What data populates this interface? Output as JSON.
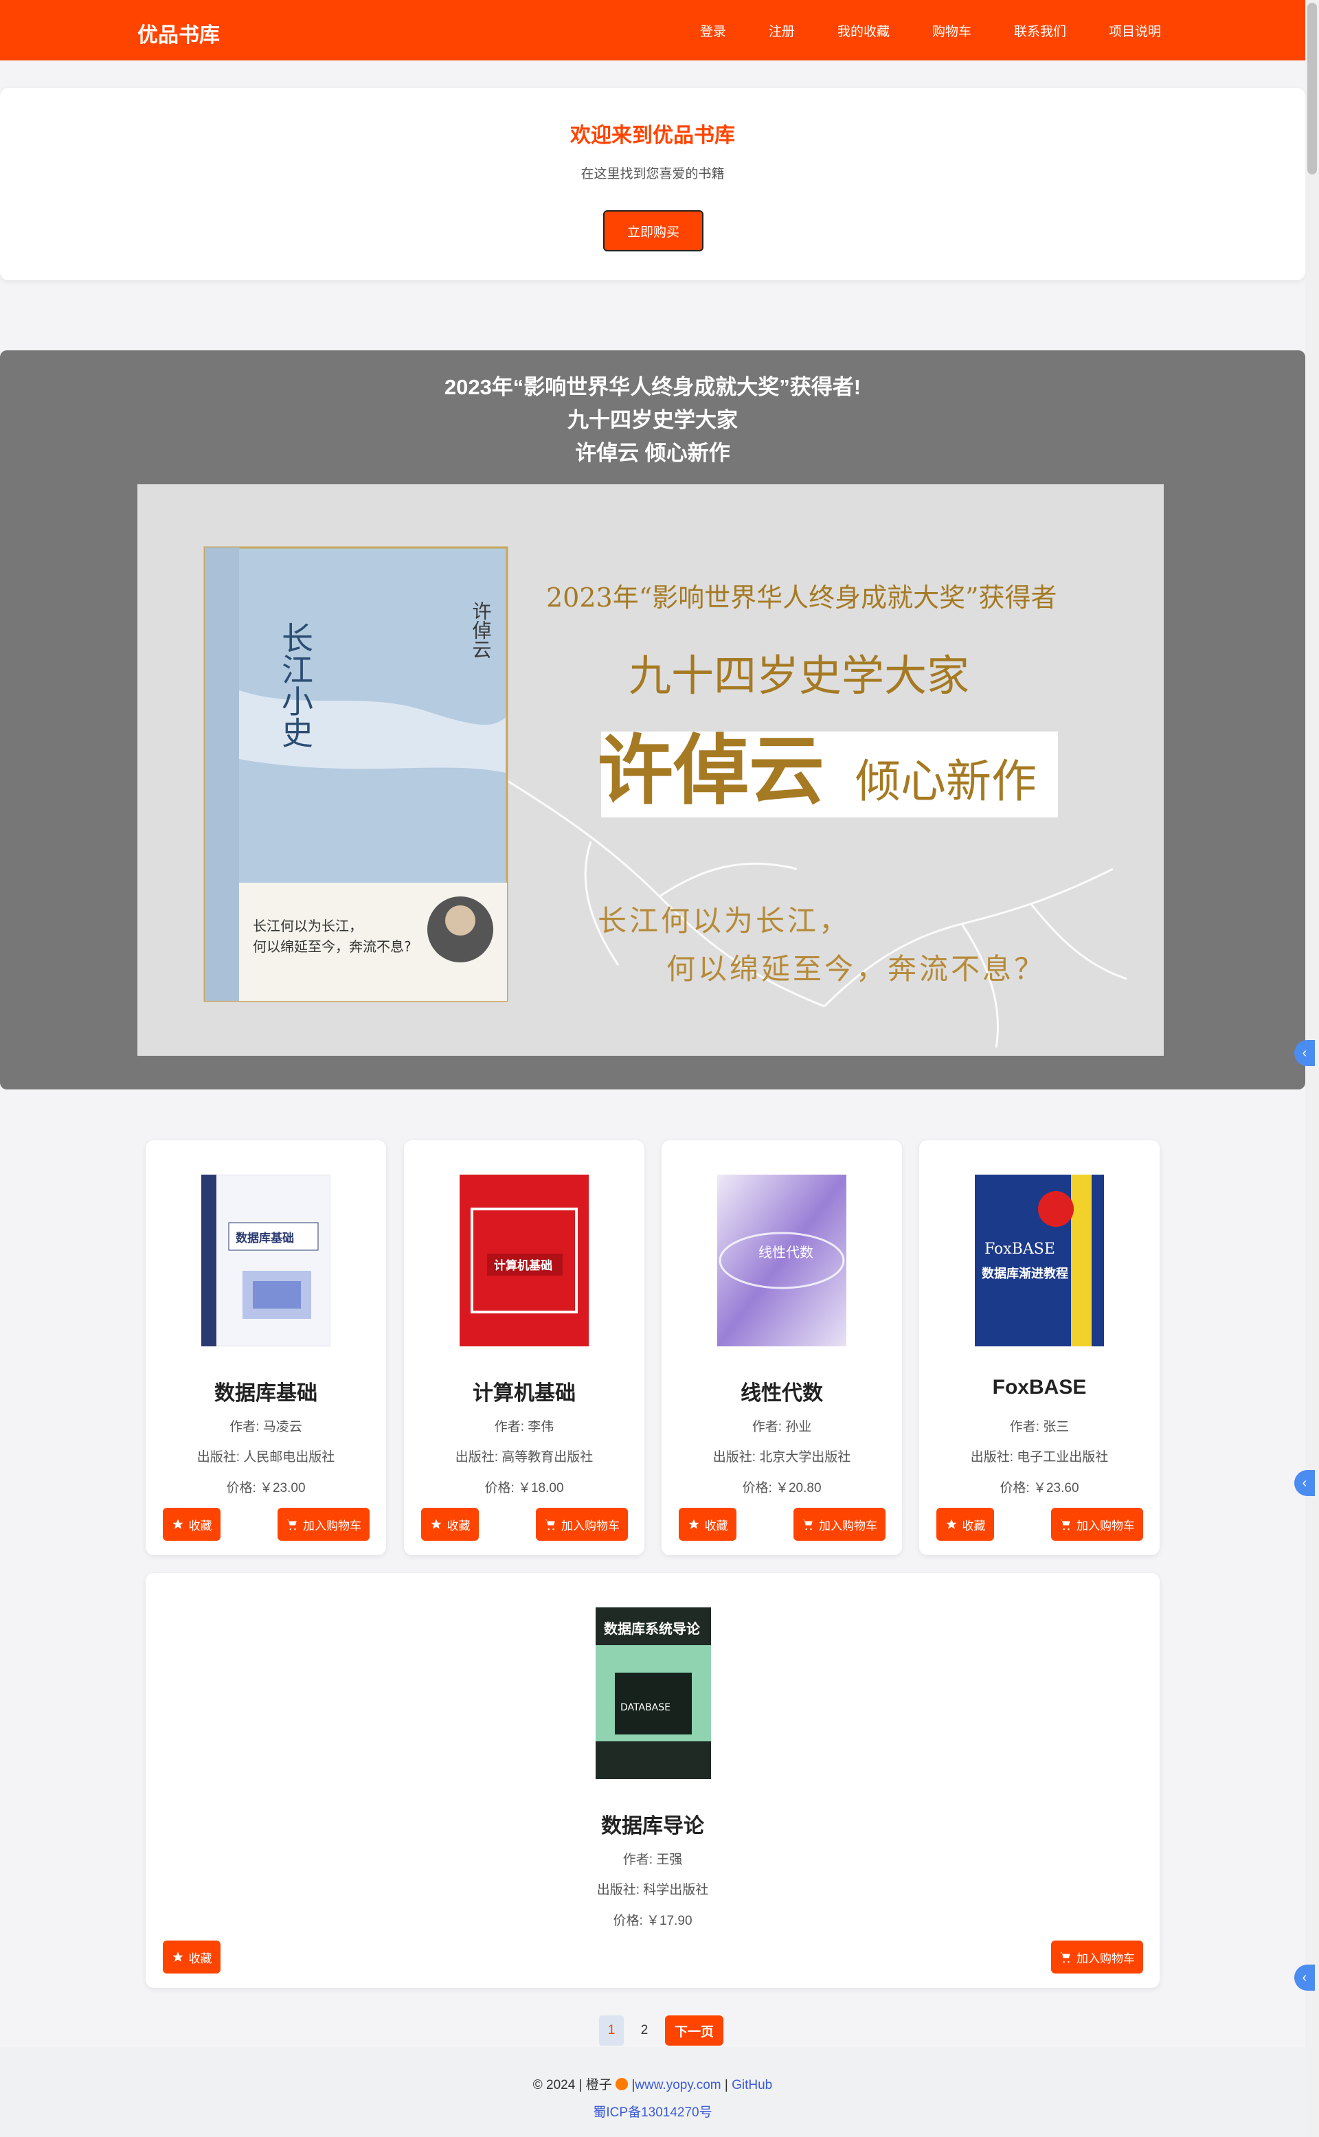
{
  "nav": {
    "brand": "优品书库",
    "links": [
      "登录",
      "注册",
      "我的收藏",
      "购物车",
      "联系我们",
      "项目说明"
    ]
  },
  "hero": {
    "title": "欢迎来到优品书库",
    "subtitle": "在这里找到您喜爱的书籍",
    "button": "立即购买"
  },
  "banner": {
    "lines": [
      "2023年“影响世界华人终身成就大奖”获得者!",
      "九十四岁史学大家",
      "许倬云 倾心新作"
    ],
    "image": {
      "book_title": "长江小史",
      "book_author": "许倬云",
      "headline1": "2023年“影响世界华人终身成就大奖”获得者",
      "headline2": "九十四岁史学大家",
      "headline3_main": "许倬云",
      "headline3_sub": "倾心新作",
      "quote1": "长江何以为长江，",
      "quote2": "何以绵延至今，奔流不息？"
    }
  },
  "books": [
    {
      "title": "数据库基础",
      "author": "作者: 马凌云",
      "publisher": "出版社: 人民邮电出版社",
      "price": "价格: ￥23.00",
      "cover_text": "数据库基础",
      "cover_color": "#eef0f6"
    },
    {
      "title": "计算机基础",
      "author": "作者: 李伟",
      "publisher": "出版社: 高等教育出版社",
      "price": "价格: ￥18.00",
      "cover_text": "计算机基础",
      "cover_color": "#d9191f"
    },
    {
      "title": "线性代数",
      "author": "作者: 孙业",
      "publisher": "出版社: 北京大学出版社",
      "price": "价格: ￥20.80",
      "cover_text": "线性代数",
      "cover_color": "#9a7fd6"
    },
    {
      "title": "FoxBASE",
      "author": "作者: 张三",
      "publisher": "出版社: 电子工业出版社",
      "price": "价格: ￥23.60",
      "cover_text": "数据库渐进教程",
      "cover_color": "#1c3a8a"
    },
    {
      "title": "数据库导论",
      "author": "作者: 王强",
      "publisher": "出版社: 科学出版社",
      "price": "价格: ￥17.90",
      "cover_text": "数据库系统导论",
      "cover_color": "#1f2a24"
    }
  ],
  "buttons": {
    "favorite": "收藏",
    "cart": "加入购物车"
  },
  "pager": {
    "page1": "1",
    "page2": "2",
    "next": "下一页"
  },
  "footer": {
    "prefix": "© 2024 | 橙子",
    "site": "www.yopy.com",
    "github": "GitHub",
    "icp": "蜀ICP备13014270号"
  },
  "colors": {
    "accent": "#ff4400",
    "banner_bg": "#777777"
  },
  "icons": [
    "star-icon",
    "cart-icon",
    "chevron-left-icon",
    "orange-emoji-icon"
  ]
}
